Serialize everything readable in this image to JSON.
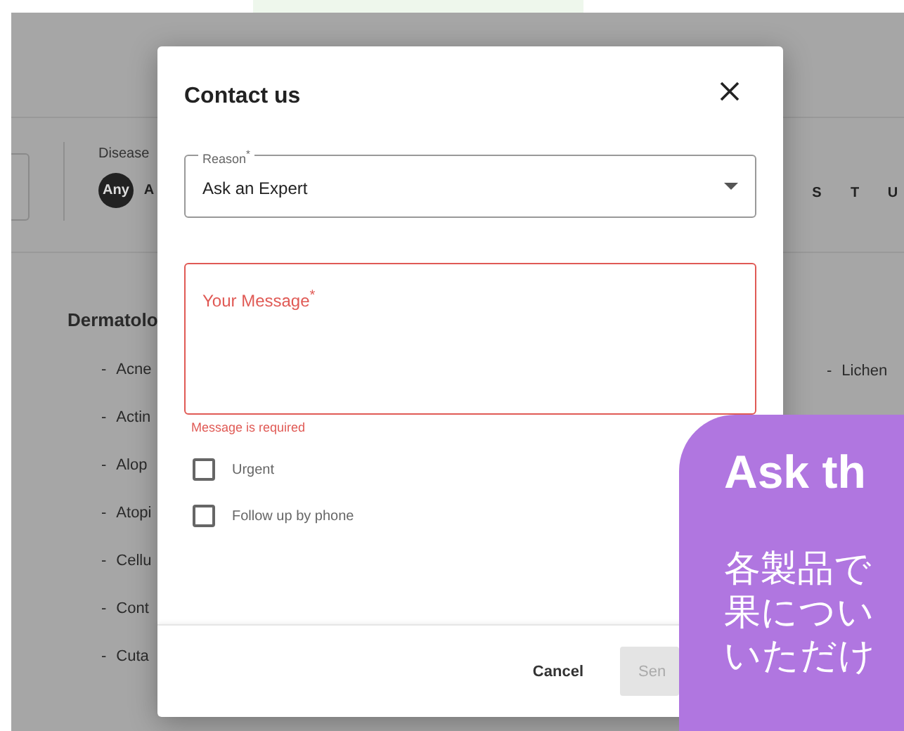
{
  "filter": {
    "label": "Disease",
    "letters": [
      {
        "label": "Any",
        "selected": true
      },
      {
        "label": "A",
        "selected": false
      }
    ],
    "letters_right": [
      {
        "label": "S",
        "selected": false
      },
      {
        "label": "T",
        "selected": false
      },
      {
        "label": "U",
        "selected": false
      }
    ]
  },
  "section": {
    "title": "Dermatolo",
    "items_left": [
      {
        "bullet": "-",
        "label": "Acne"
      },
      {
        "bullet": "-",
        "label": "Actin"
      },
      {
        "bullet": "-",
        "label": "Alop"
      },
      {
        "bullet": "-",
        "label": "Atopi"
      },
      {
        "bullet": "-",
        "label": "Cellu"
      },
      {
        "bullet": "-",
        "label": "Cont"
      },
      {
        "bullet": "-",
        "label": "Cuta"
      }
    ],
    "items_right": [
      {
        "bullet": "-",
        "label": "Lichen"
      }
    ]
  },
  "modal": {
    "title": "Contact us",
    "reason": {
      "label": "Reason$^{*}$",
      "value": "Ask an Expert"
    },
    "message": {
      "label": "Your Message$^{*}$",
      "error": true,
      "error_text": "Message is required"
    },
    "checkboxes": [
      {
        "label": "Urgent",
        "checked": false
      },
      {
        "label": "Follow up by phone",
        "checked": false
      }
    ],
    "cancel": "Cancel",
    "send": {
      "label": "Sen",
      "disabled": true
    }
  },
  "callout": {
    "title": "Ask th",
    "lines": [
      "各製品で",
      "果につい",
      "いただけ"
    ]
  }
}
